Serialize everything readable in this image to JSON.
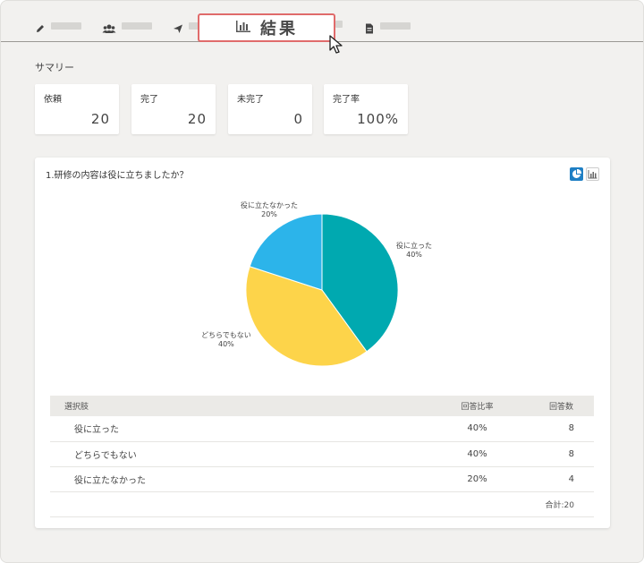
{
  "tabs": {
    "active_label": "結果",
    "active_icon": "bar-chart-icon",
    "other_icons": [
      "pencil-icon",
      "users-icon",
      "send-icon",
      "document-icon"
    ]
  },
  "summary": {
    "title": "サマリー",
    "cards": [
      {
        "label": "依頼",
        "value": "20"
      },
      {
        "label": "完了",
        "value": "20"
      },
      {
        "label": "未完了",
        "value": "0"
      },
      {
        "label": "完了率",
        "value": "100%"
      }
    ]
  },
  "question": {
    "title": "1.研修の内容は役に立ちましたか？",
    "view_toggles": [
      "pie-chart-icon",
      "bar-chart-icon"
    ]
  },
  "chart_data": {
    "type": "pie",
    "categories": [
      "役に立った",
      "どちらでもない",
      "役に立たなかった"
    ],
    "values": [
      40,
      40,
      20
    ],
    "value_labels": [
      "40%",
      "40%",
      "20%"
    ],
    "colors": [
      "#00a9b0",
      "#fdd44a",
      "#2cb4ea"
    ]
  },
  "table": {
    "headers": [
      "選択肢",
      "回答比率",
      "回答数"
    ],
    "rows": [
      [
        "役に立った",
        "40%",
        "8"
      ],
      [
        "どちらでもない",
        "40%",
        "8"
      ],
      [
        "役に立たなかった",
        "20%",
        "4"
      ]
    ],
    "total": "合計:20"
  }
}
